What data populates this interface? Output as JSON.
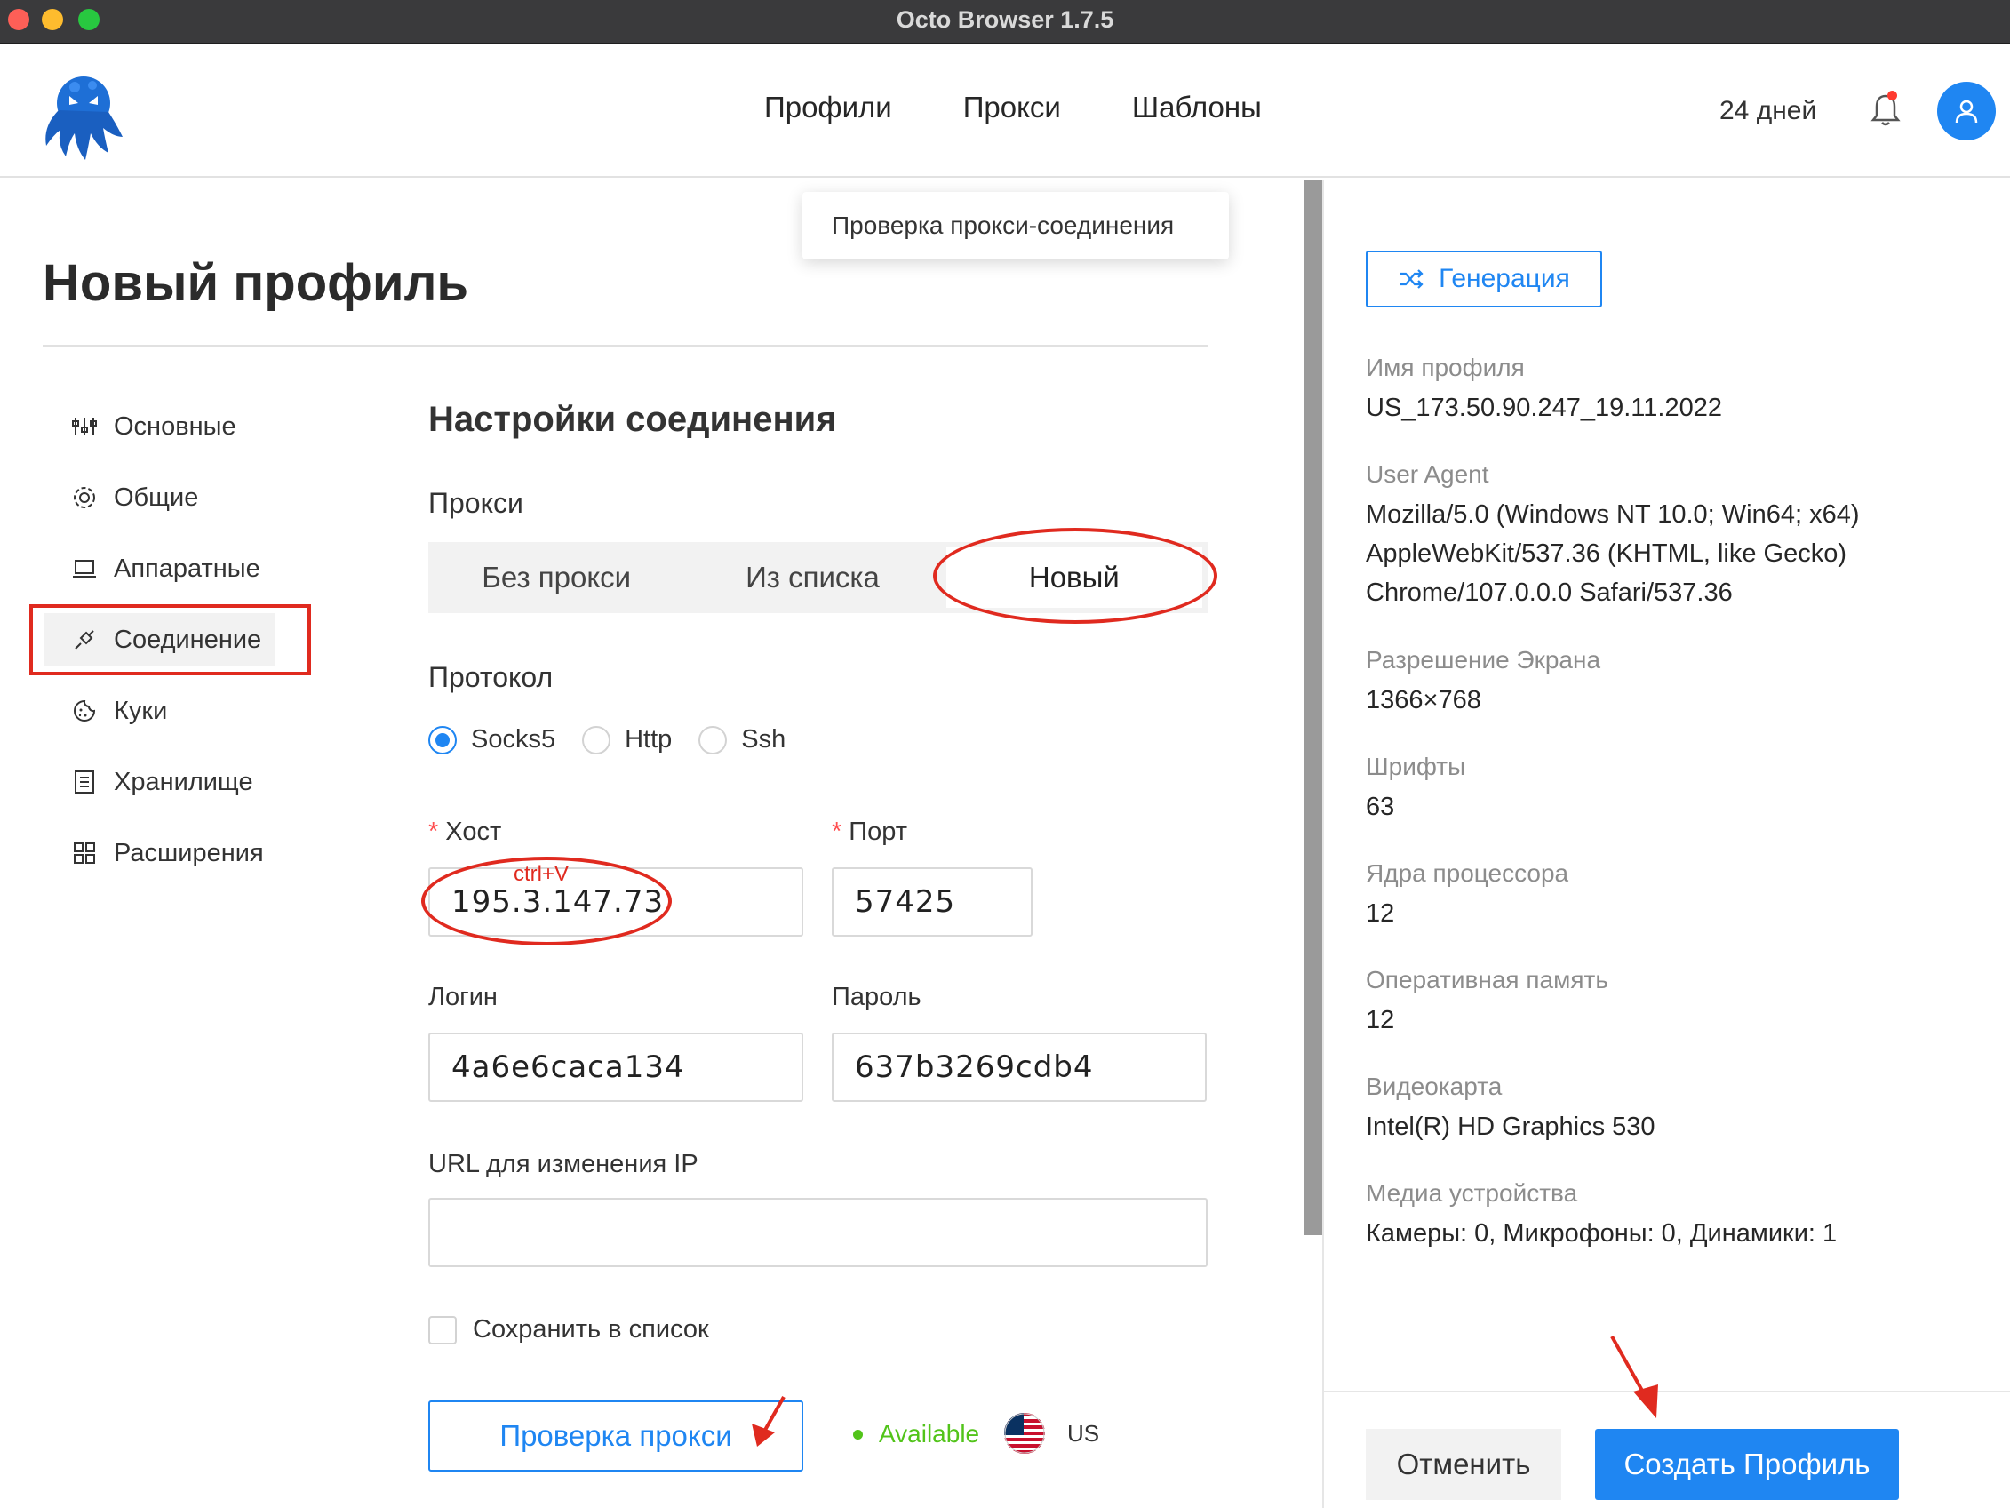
{
  "window": {
    "title": "Octo Browser 1.7.5"
  },
  "nav": {
    "items": [
      "Профили",
      "Прокси",
      "Шаблоны"
    ],
    "days_left": "24 дней"
  },
  "tooltip": "Проверка прокси-соединения",
  "page": {
    "title": "Новый профиль"
  },
  "sidebar": {
    "items": [
      {
        "label": "Основные",
        "icon": "sliders-icon"
      },
      {
        "label": "Общие",
        "icon": "gear-icon"
      },
      {
        "label": "Аппаратные",
        "icon": "laptop-icon"
      },
      {
        "label": "Соединение",
        "icon": "plug-icon",
        "active": true
      },
      {
        "label": "Куки",
        "icon": "cookie-icon"
      },
      {
        "label": "Хранилище",
        "icon": "storage-icon"
      },
      {
        "label": "Расширения",
        "icon": "extensions-icon"
      }
    ]
  },
  "connection": {
    "title": "Настройки соединения",
    "proxy_label": "Прокси",
    "proxy_options": [
      "Без прокси",
      "Из списка",
      "Новый"
    ],
    "proxy_selected": "Новый",
    "protocol_label": "Протокол",
    "protocols": [
      "Socks5",
      "Http",
      "Ssh"
    ],
    "protocol_selected": "Socks5",
    "host_label": "Хост",
    "host_value": "195.3.147.73",
    "host_annotation": "ctrl+V",
    "port_label": "Порт",
    "port_value": "57425",
    "login_label": "Логин",
    "login_value": "4a6e6caca134",
    "password_label": "Пароль",
    "password_value": "637b3269cdb4",
    "ip_url_label": "URL для изменения IP",
    "ip_url_value": "",
    "save_to_list": "Сохранить в список",
    "check_button": "Проверка прокси",
    "status": "Available",
    "country": "US"
  },
  "summary": {
    "generate_button": "Генерация",
    "profile_name_label": "Имя профиля",
    "profile_name": "US_173.50.90.247_19.11.2022",
    "ua_label": "User Agent",
    "ua_lines": [
      "Mozilla/5.0 (Windows NT 10.0; Win64; x64)",
      "AppleWebKit/537.36 (KHTML, like Gecko)",
      "Chrome/107.0.0.0 Safari/537.36"
    ],
    "resolution_label": "Разрешение Экрана",
    "resolution": "1366×768",
    "fonts_label": "Шрифты",
    "fonts": "63",
    "cpu_label": "Ядра процессора",
    "cpu": "12",
    "ram_label": "Оперативная память",
    "ram": "12",
    "gpu_label": "Видеокарта",
    "gpu": "Intel(R) HD Graphics 530",
    "media_label": "Медиа устройства",
    "media": "Камеры: 0, Микрофоны: 0, Динамики: 1"
  },
  "footer": {
    "cancel": "Отменить",
    "create": "Создать Профиль"
  },
  "colors": {
    "accent": "#1f86f2",
    "annotation_red": "#e02a1f",
    "available_green": "#52c41a"
  }
}
